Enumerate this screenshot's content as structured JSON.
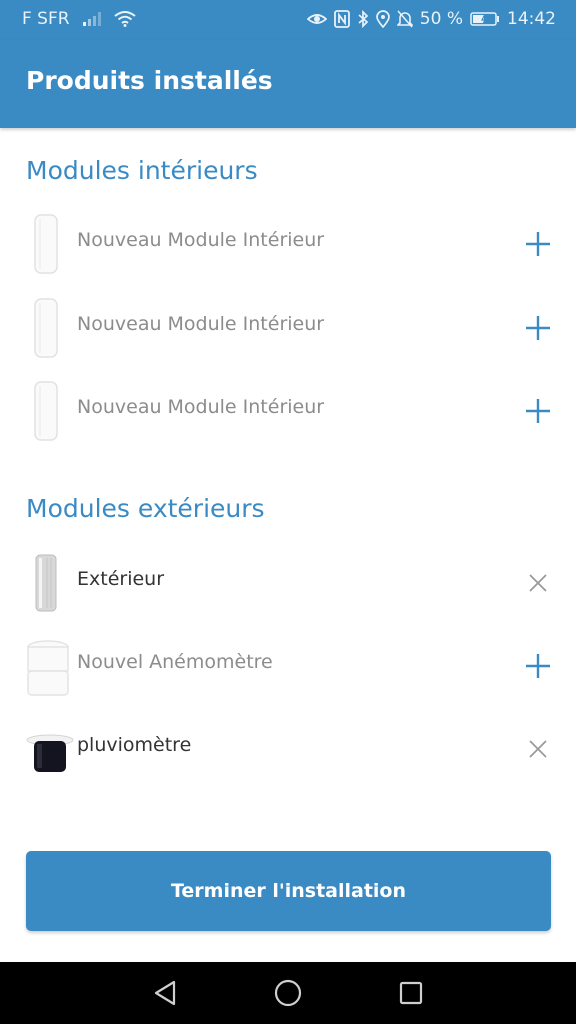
{
  "status_bar": {
    "carrier": "F SFR",
    "battery_percent": "50 %",
    "time": "14:42",
    "icons": [
      "signal-icon",
      "wifi-icon",
      "eye-icon",
      "nfc-icon",
      "bluetooth-icon",
      "location-icon",
      "bell-off-icon",
      "battery-icon"
    ]
  },
  "header": {
    "title": "Produits installés"
  },
  "indoor": {
    "title": "Modules intérieurs",
    "items": [
      {
        "name": "Nouveau Module Intérieur",
        "action": "add"
      },
      {
        "name": "Nouveau Module Intérieur",
        "action": "add"
      },
      {
        "name": "Nouveau Module Intérieur",
        "action": "add"
      }
    ]
  },
  "outdoor": {
    "title": "Modules extérieurs",
    "items": [
      {
        "name": "Extérieur",
        "action": "remove"
      },
      {
        "name": "Nouvel Anémomètre",
        "action": "add"
      },
      {
        "name": "pluviomètre",
        "action": "remove"
      }
    ]
  },
  "finish_button": {
    "label": "Terminer l'installation"
  },
  "nav": {
    "items": [
      "back-icon",
      "home-icon",
      "recents-icon"
    ]
  },
  "colors": {
    "accent": "#3a8ac4",
    "muted_text": "#8c8c8c",
    "icon_gray": "#9a9a9a"
  }
}
